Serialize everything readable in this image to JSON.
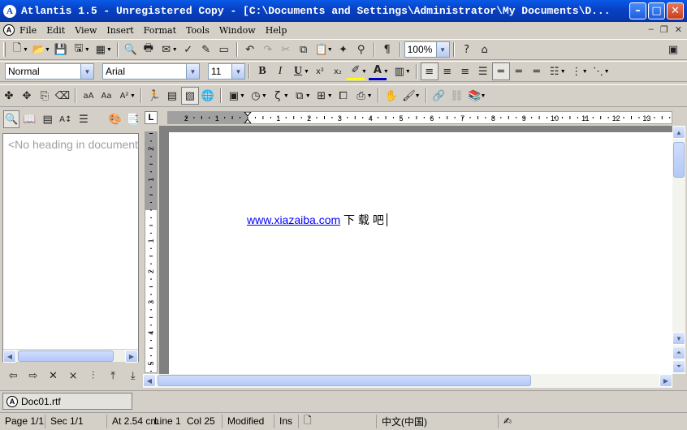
{
  "window": {
    "title": "Atlantis 1.5 - Unregistered Copy - [C:\\Documents and Settings\\Administrator\\My Documents\\D...",
    "app_logo_letter": "A"
  },
  "menu": [
    "File",
    "Edit",
    "View",
    "Insert",
    "Format",
    "Tools",
    "Window",
    "Help"
  ],
  "toolbar": {
    "zoom": "100%",
    "style": "Normal",
    "font": "Arial",
    "size": "11",
    "bold": "B",
    "italic": "I",
    "underline": "U",
    "pilcrow": "¶"
  },
  "left_panel": {
    "placeholder": "<No heading in document>"
  },
  "document": {
    "link_text": "www.xiazaiba.com",
    "text": " 下 载 吧",
    "ruler_numbers": [
      "2",
      "1",
      "1",
      "2",
      "3",
      "4",
      "5",
      "6",
      "7",
      "8",
      "9",
      "10",
      "11",
      "12",
      "13"
    ],
    "vruler_numbers": [
      "2",
      "1",
      "1",
      "2",
      "3",
      "4",
      "5"
    ]
  },
  "tabs": [
    {
      "label": "Doc01.rtf"
    }
  ],
  "status": {
    "page": "Page 1/1",
    "section": "Sec 1/1",
    "position": "At 2.54 cm",
    "line": "Line 1",
    "col": "Col 25",
    "modified": "Modified",
    "mode": "Ins",
    "language": "中文(中国)"
  }
}
